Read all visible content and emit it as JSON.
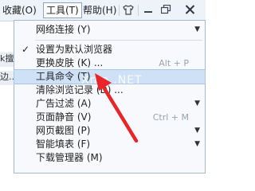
{
  "menubar": {
    "favorites": "收藏(O)",
    "tools": "工具(T)",
    "help": "帮助(H)"
  },
  "background": {
    "frag1": "k擅",
    "frag2": "边..."
  },
  "menu": {
    "items": [
      {
        "label": "网络连接 (Y)",
        "checked": false,
        "shortcut": "",
        "submenu": true
      },
      {
        "label": "设置为默认浏览器",
        "checked": true,
        "shortcut": "",
        "submenu": false
      },
      {
        "label": "更换皮肤 (K) ...",
        "checked": false,
        "shortcut": "Alt + P",
        "submenu": false
      },
      {
        "label": "工具命令 (T) ...",
        "checked": false,
        "shortcut": "",
        "submenu": false,
        "highlighted": true
      },
      {
        "label": "清除浏览记录 (D) ...",
        "checked": false,
        "shortcut": "",
        "submenu": false
      },
      {
        "label": "广告过滤 (A)",
        "checked": false,
        "shortcut": "",
        "submenu": true
      },
      {
        "label": "页面静音 (V)",
        "checked": false,
        "shortcut": "Ctrl + M",
        "submenu": false
      },
      {
        "label": "网页截图 (P)",
        "checked": false,
        "shortcut": "",
        "submenu": true
      },
      {
        "label": "智能填表 (F)",
        "checked": false,
        "shortcut": "",
        "submenu": true
      },
      {
        "label": "下载管理器 (M)",
        "checked": false,
        "shortcut": "",
        "submenu": false
      }
    ]
  },
  "watermark": "Xme .NET",
  "colors": {
    "highlight": "#cfe1f7",
    "arrow": "#e8262a"
  }
}
